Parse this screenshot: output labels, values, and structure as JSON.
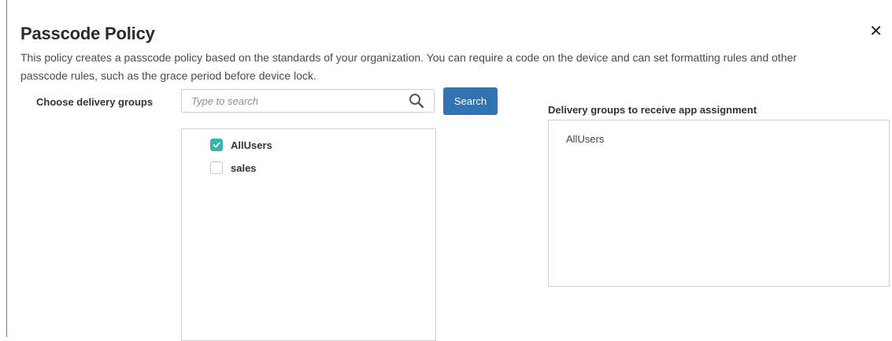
{
  "dialog": {
    "title": "Passcode Policy",
    "close_icon": "close-icon",
    "description": "This policy creates a passcode policy based on the standards of your organization. You can require a code on the device and can set formatting rules and other passcode rules, such as the grace period before device lock."
  },
  "delivery": {
    "choose_label": "Choose delivery groups",
    "search": {
      "placeholder": "Type to search",
      "value": "",
      "icon": "search-icon"
    },
    "search_button_label": "Search",
    "groups": [
      {
        "label": "AllUsers",
        "checked": true
      },
      {
        "label": "sales",
        "checked": false
      }
    ],
    "receive_label": "Delivery groups to receive app assignment",
    "receive_items": [
      "AllUsers"
    ]
  },
  "colors": {
    "accent_button": "#2f73b4",
    "checkbox_checked": "#3bb3ad"
  }
}
